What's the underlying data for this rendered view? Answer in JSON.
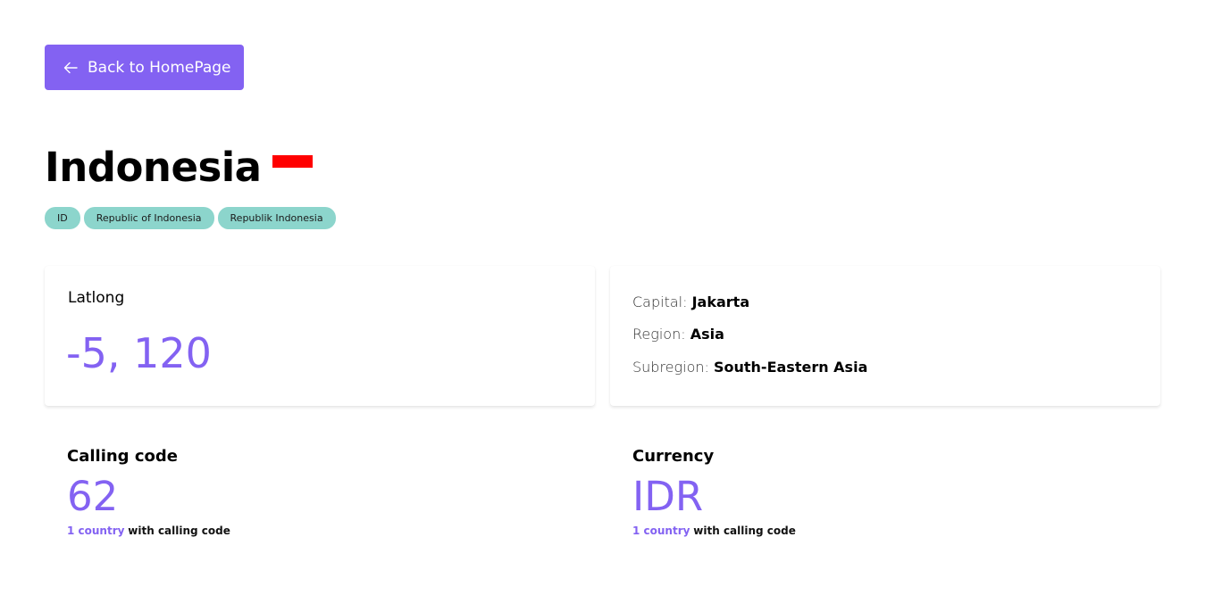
{
  "back_button": {
    "label": "Back to HomePage",
    "icon": "arrow-left-icon"
  },
  "country": {
    "name": "Indonesia",
    "flag_colors": [
      "#ff0000",
      "#ffffff"
    ],
    "tags": [
      "ID",
      "Republic of Indonesia",
      "Republik Indonesia"
    ]
  },
  "latlong": {
    "label": "Latlong",
    "value": "-5, 120"
  },
  "info": {
    "capital_label": "Capital:",
    "capital": "Jakarta",
    "region_label": "Region:",
    "region": "Asia",
    "subregion_label": "Subregion:",
    "subregion": "South-Eastern Asia"
  },
  "calling_code": {
    "title": "Calling code",
    "value": "62",
    "note_highlight": "1 country",
    "note_rest": "with calling code"
  },
  "currency": {
    "title": "Currency",
    "value": "IDR",
    "note_highlight": "1 country",
    "note_rest": "with calling code"
  },
  "colors": {
    "accent": "#8362f2",
    "tag_bg": "#8cd5cc",
    "flag_red": "#ff0000"
  }
}
